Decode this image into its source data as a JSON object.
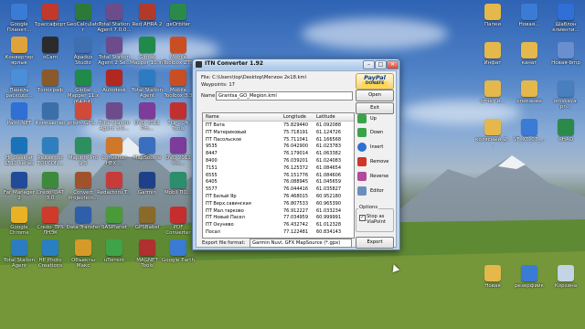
{
  "desktop": {
    "left_icons": [
      {
        "label": "Google Планет...",
        "color": "#3a7bd5"
      },
      {
        "label": "Трассафорт",
        "color": "#c0392b"
      },
      {
        "label": "GeoCalculator",
        "color": "#2c7a3a"
      },
      {
        "label": "Total Station Agent 7.0.0...",
        "color": "#6d4c8c"
      },
      {
        "label": "Red AHRA 2",
        "color": "#b23a2a"
      },
      {
        "label": "geOrbiter",
        "color": "#2a8a4a"
      },
      {
        "label": "Конвертер ярлык",
        "color": "#e0a23a"
      },
      {
        "label": "oCam",
        "color": "#2b2b2b"
      },
      {
        "label": "Apadus Studio",
        "color": "#3f6fb0"
      },
      {
        "label": "Total Station Agent 2 Se...",
        "color": "#6d4c8c"
      },
      {
        "label": "Global Mapper 10.ini",
        "color": "#1f8a4a"
      },
      {
        "label": "Mobile Toolbox ZTS",
        "color": "#c94f23"
      },
      {
        "label": "Панель расходо...",
        "color": "#4a8fd8"
      },
      {
        "label": "Топограф",
        "color": "#8a5a2a"
      },
      {
        "label": "Global Mapper 11.x (64-bit)",
        "color": "#1f8a4a"
      },
      {
        "label": "Autodesk",
        "color": "#b0281f"
      },
      {
        "label": "Total Station Agent",
        "color": "#2d7cc1"
      },
      {
        "label": "Mobile Toolbox 3.3",
        "color": "#c94f23"
      },
      {
        "label": "Paint.NET",
        "color": "#2f6fd6"
      },
      {
        "label": "Компьютер",
        "color": "#3b6fa8"
      },
      {
        "label": "prism_GPS...",
        "color": "#d04a3a"
      },
      {
        "label": "Total Station Agent 3.0...",
        "color": "#6d4c8c"
      },
      {
        "label": "DVD 2011 Pm...",
        "color": "#7d3b9a"
      },
      {
        "label": "TOPCON Tools",
        "color": "#c03030"
      },
      {
        "label": "HP DeskJet 1510 series",
        "color": "#1a73b8"
      },
      {
        "label": "Редактор TOPCON...",
        "color": "#2f7fbf"
      },
      {
        "label": "Mapinfo Pro 9.5",
        "color": "#2d8f5f"
      },
      {
        "label": "Converter HEX ...",
        "color": "#d0772a"
      },
      {
        "label": "MapSource",
        "color": "#3a6fbf"
      },
      {
        "label": "DVD 2011 Pro...",
        "color": "#7d3b9a"
      },
      {
        "label": "Far Manager 2",
        "color": "#224a9a"
      },
      {
        "label": "Credo_DAT 3.0",
        "color": "#3d8a3d"
      },
      {
        "label": "Convert Projection...",
        "color": "#a0522d"
      },
      {
        "label": "Redactoru T...",
        "color": "#c73b3b"
      },
      {
        "label": "Garmin",
        "color": "#1e3f8a"
      },
      {
        "label": "Mobil ПО...",
        "color": "#2a8f6a"
      },
      {
        "label": "Google Chrome",
        "color": "#e8b224"
      },
      {
        "label": "Credo_TPS ЛНЭК",
        "color": "#cf3a2a"
      },
      {
        "label": "Data Transfer",
        "color": "#2f5faa"
      },
      {
        "label": "SASPlanet",
        "color": "#4a9a3a"
      },
      {
        "label": "GPSBabel",
        "color": "#8a6a2a"
      },
      {
        "label": "PDF Converter",
        "color": "#c62e2e"
      },
      {
        "label": "Total Station Agent",
        "color": "#2d7cc1"
      },
      {
        "label": "HP Photo Creations",
        "color": "#2a7fc0"
      },
      {
        "label": "Объекты Макс",
        "color": "#d69a2a"
      },
      {
        "label": "uTorrent",
        "color": "#3fa34a"
      },
      {
        "label": "MAGNET Tools",
        "color": "#b02f2f"
      },
      {
        "label": "Google Earth",
        "color": "#3a7bd5"
      }
    ],
    "right_icons": [
      {
        "label": "Папки",
        "color": "#e4b84a"
      },
      {
        "label": "Новая...",
        "color": "#3a7bd5"
      },
      {
        "label": "Шаблон клиенти...",
        "color": "#2f6fd6"
      },
      {
        "label": "Инфат",
        "color": "#e4b84a"
      },
      {
        "label": "канат",
        "color": "#e4b84a"
      },
      {
        "label": "Новая-bmp",
        "color": "#6a8fcf"
      },
      {
        "label": "отчет и...",
        "color": "#e4b84a"
      },
      {
        "label": "описание",
        "color": "#e4b84a"
      },
      {
        "label": "omskaya-pn...",
        "color": "#4a7fbf"
      },
      {
        "label": "колясный_2...",
        "color": "#e4b84a"
      },
      {
        "label": "VF_XT_07_...",
        "color": "#3a7bd5"
      },
      {
        "label": "ЯНАО",
        "color": "#2a8a4a"
      },
      {
        "label": "Новая",
        "color": "#e4b84a"
      },
      {
        "label": "резерфийк",
        "color": "#3a7bd5"
      },
      {
        "label": "Корзина",
        "color": "#c4d4e4"
      }
    ]
  },
  "window": {
    "title": "ITN Converter 1.92",
    "file_label": "File: C:\\Users\\top\\Desktop\\Мегион 2к18.kml",
    "waypoints_label": "Waypoints: 17",
    "name_label": "Name",
    "name_value": "Grantsa_GO_Megion.kml",
    "paypal": {
      "line1": "PayPal",
      "line2": "DONATE"
    },
    "columns": [
      "Name",
      "Longitude",
      "Latitude"
    ],
    "rows": [
      [
        "ПТ Вата",
        "75.829440",
        "61.092088"
      ],
      [
        "ПТ Материковый",
        "75.718191",
        "61.124726"
      ],
      [
        "ПТ Пасольское",
        "75.711041",
        "61.166568"
      ],
      [
        "9535",
        "76.042900",
        "61.023783"
      ],
      [
        "8447",
        "76.179014",
        "61.063382"
      ],
      [
        "8400",
        "76.039201",
        "61.024083"
      ],
      [
        "7151",
        "76.125372",
        "61.084654"
      ],
      [
        "6555",
        "76.151776",
        "61.084606"
      ],
      [
        "6405",
        "76.088945",
        "61.045659"
      ],
      [
        "5577",
        "76.044416",
        "61.035827"
      ],
      [
        "ПТ Белый Яр",
        "76.468015",
        "60.952180"
      ],
      [
        "ПТ Верх.савинская",
        "76.807533",
        "60.965390"
      ],
      [
        "ПТ Мал.тарково",
        "76.912227",
        "61.033234"
      ],
      [
        "ПТ Новый Пасел",
        "77.034959",
        "60.999991"
      ],
      [
        "ПТ Окунево",
        "76.432742",
        "61.012328"
      ],
      [
        "Посал",
        "77.122481",
        "60.834143"
      ]
    ],
    "buttons": {
      "open": "Open",
      "exit": "Exit",
      "up": "Up",
      "down": "Down",
      "insert": "Insert",
      "remove": "Remove",
      "reverse": "Reverse",
      "editor": "Editor",
      "export": "Export"
    },
    "options": {
      "title": "Options",
      "stop_as_via": "Stop as ViaPoint"
    },
    "export_format_label": "Export file format:",
    "export_format_value": "Garmin Nuvi, GFX MapSource (*.gpx)"
  }
}
